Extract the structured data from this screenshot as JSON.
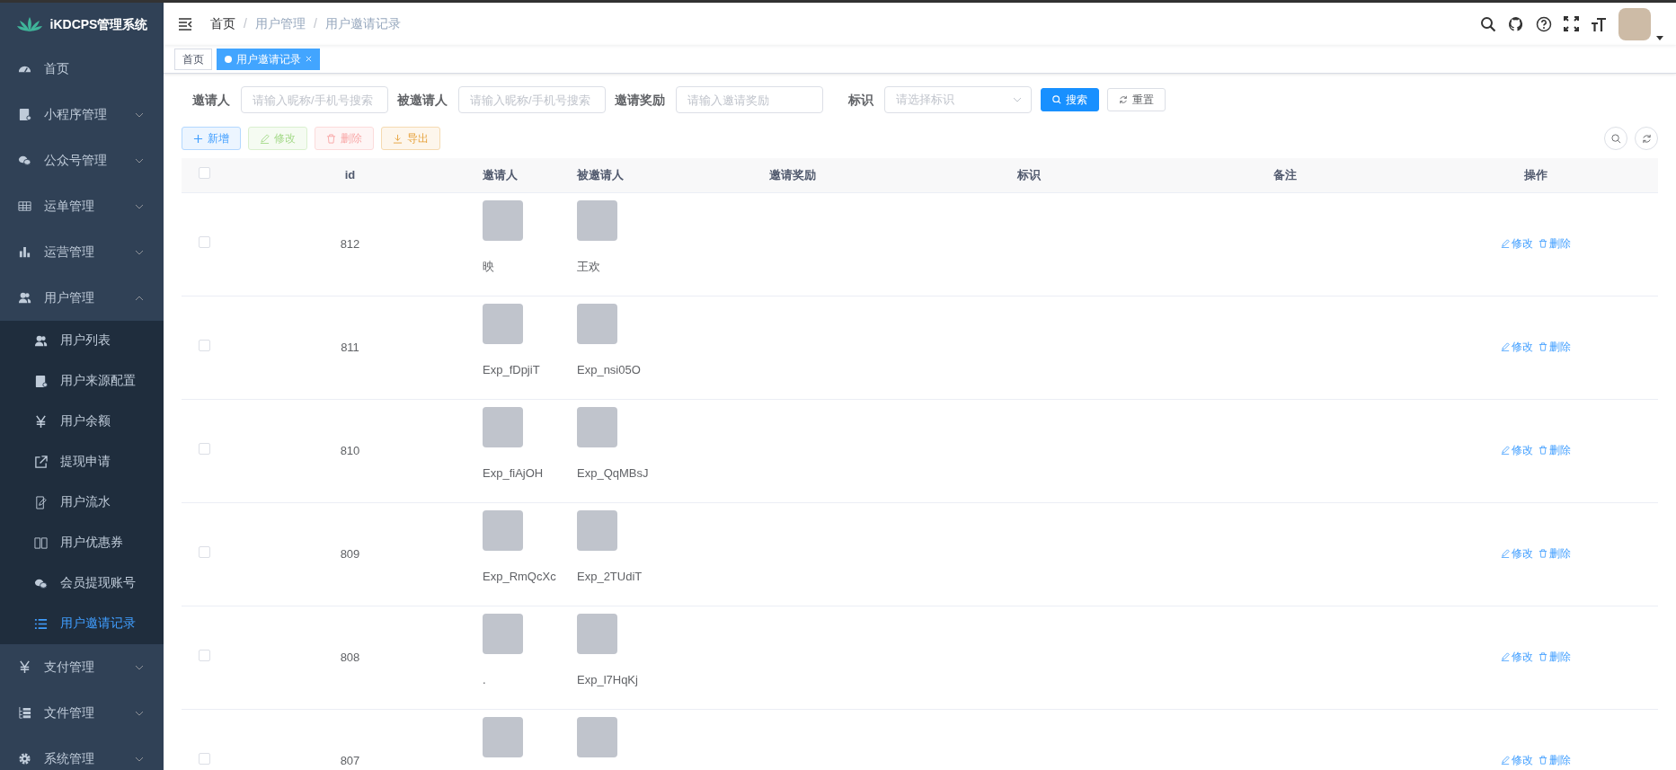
{
  "sidebar": {
    "title": "iKDCPS管理系统",
    "items": [
      {
        "label": "首页",
        "selected": false
      },
      {
        "label": "小程序管理",
        "expanded": false,
        "selected": false
      },
      {
        "label": "公众号管理",
        "expanded": false,
        "selected": false
      },
      {
        "label": "运单管理",
        "expanded": false,
        "selected": false
      },
      {
        "label": "运营管理",
        "expanded": false,
        "selected": false
      },
      {
        "label": "用户管理",
        "expanded": true,
        "selected": false,
        "children": [
          {
            "label": "用户列表",
            "selected": false
          },
          {
            "label": "用户来源配置",
            "selected": false
          },
          {
            "label": "用户余额",
            "selected": false
          },
          {
            "label": "提现申请",
            "selected": false
          },
          {
            "label": "用户流水",
            "selected": false
          },
          {
            "label": "用户优惠券",
            "selected": false
          },
          {
            "label": "会员提现账号",
            "selected": false
          },
          {
            "label": "用户邀请记录",
            "selected": true
          }
        ]
      },
      {
        "label": "支付管理",
        "expanded": false,
        "selected": false
      },
      {
        "label": "文件管理",
        "expanded": false,
        "selected": false
      },
      {
        "label": "系统管理",
        "expanded": false,
        "selected": false
      }
    ]
  },
  "breadcrumb": [
    {
      "kind": "link",
      "label": "首页"
    },
    {
      "kind": "separator",
      "label": "/"
    },
    {
      "kind": "link",
      "label": "用户管理"
    },
    {
      "kind": "separator",
      "label": "/"
    },
    {
      "kind": "current",
      "label": "用户邀请记录"
    }
  ],
  "tabs": [
    {
      "label": "首页",
      "selected": false
    },
    {
      "label": "用户邀请记录",
      "selected": true
    }
  ],
  "filters": [
    {
      "kind": "input",
      "label": "邀请人",
      "placeholder": "请输入昵称/手机号搜索"
    },
    {
      "kind": "input",
      "label": "被邀请人",
      "placeholder": "请输入昵称/手机号搜索"
    },
    {
      "kind": "input",
      "label": "邀请奖励",
      "placeholder": "请输入邀请奖励"
    },
    {
      "kind": "select",
      "label": "标识",
      "placeholder": "请选择标识"
    }
  ],
  "filter_buttons": [
    {
      "kind": "primary",
      "label": "搜索"
    },
    {
      "kind": "default",
      "label": "重置"
    }
  ],
  "toolbar": [
    {
      "kind": "primary",
      "label": "新增",
      "disabled": false
    },
    {
      "kind": "success",
      "label": "修改",
      "disabled": true
    },
    {
      "kind": "danger",
      "label": "删除",
      "disabled": true
    },
    {
      "kind": "warning",
      "label": "导出",
      "disabled": false
    }
  ],
  "table": {
    "header_checked": false,
    "columns": [
      "id",
      "邀请人",
      "被邀请人",
      "邀请奖励",
      "标识",
      "备注",
      "操作"
    ],
    "rows": [
      {
        "checked": false,
        "id": "812",
        "inviter": "映",
        "invitee": "王欢",
        "actions": [
          "修改",
          "删除"
        ]
      },
      {
        "checked": false,
        "id": "811",
        "inviter": "Exp_fDpjiT",
        "invitee": "Exp_nsi05O",
        "actions": [
          "修改",
          "删除"
        ]
      },
      {
        "checked": false,
        "id": "810",
        "inviter": "Exp_fiAjOH",
        "invitee": "Exp_QqMBsJ",
        "actions": [
          "修改",
          "删除"
        ]
      },
      {
        "checked": false,
        "id": "809",
        "inviter": "Exp_RmQcXc",
        "invitee": "Exp_2TUdiT",
        "actions": [
          "修改",
          "删除"
        ]
      },
      {
        "checked": false,
        "id": "808",
        "inviter": ".",
        "invitee": "Exp_l7HqKj",
        "actions": [
          "修改",
          "删除"
        ]
      },
      {
        "checked": false,
        "id": "807",
        "actions": [
          "修改",
          "删除"
        ]
      }
    ]
  }
}
